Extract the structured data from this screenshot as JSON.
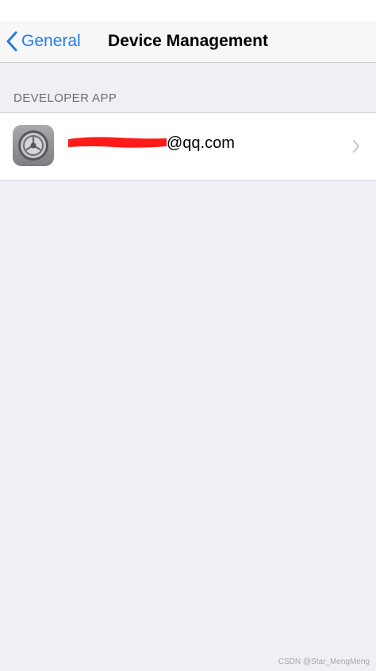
{
  "navbar": {
    "back_label": "General",
    "title": "Device Management"
  },
  "section": {
    "header": "DEVELOPER APP"
  },
  "row": {
    "email_suffix": "@qq.com",
    "icon": "settings-gear-icon",
    "chevron": "chevron-right-icon"
  },
  "watermark": "CSDN @Star_MengMeng",
  "colors": {
    "accent": "#1f7cf0",
    "background": "#efeff4",
    "redaction": "#ff1a1a"
  }
}
